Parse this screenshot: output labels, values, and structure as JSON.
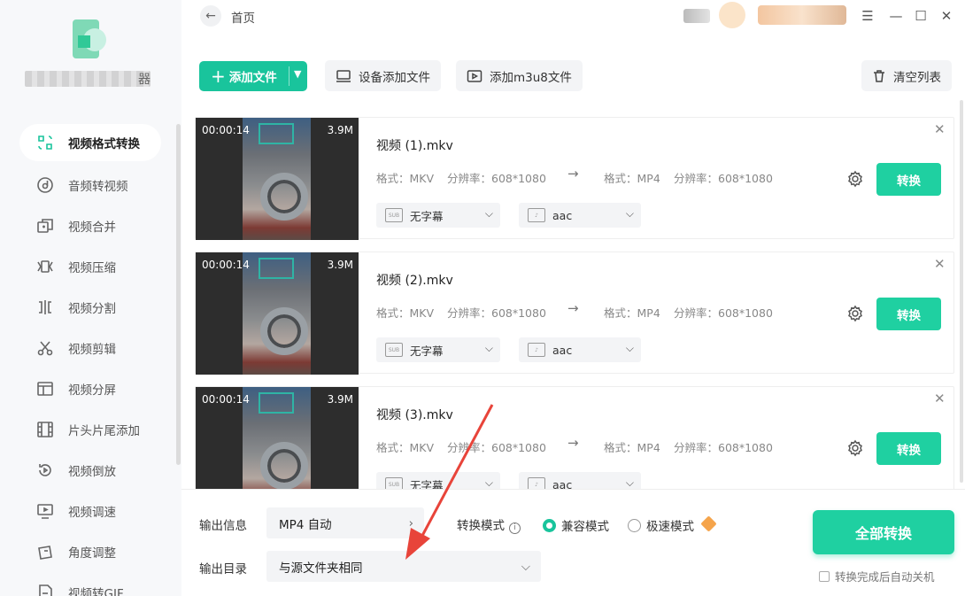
{
  "topbar": {
    "breadcrumb": "首页",
    "back_icon": "arrow-left-icon"
  },
  "sidebar": {
    "app_name_tail": "器",
    "items": [
      {
        "label": "视频格式转换",
        "icon": "format-convert-icon"
      },
      {
        "label": "音频转视频",
        "icon": "audio-icon"
      },
      {
        "label": "视频合并",
        "icon": "merge-icon"
      },
      {
        "label": "视频压缩",
        "icon": "compress-icon"
      },
      {
        "label": "视频分割",
        "icon": "split-icon"
      },
      {
        "label": "视频剪辑",
        "icon": "scissors-icon"
      },
      {
        "label": "视频分屏",
        "icon": "split-screen-icon"
      },
      {
        "label": "片头片尾添加",
        "icon": "film-icon"
      },
      {
        "label": "视频倒放",
        "icon": "reverse-icon"
      },
      {
        "label": "视频调速",
        "icon": "speed-icon"
      },
      {
        "label": "角度调整",
        "icon": "rotate-icon"
      },
      {
        "label": "视频转GIF",
        "icon": "gif-icon"
      }
    ]
  },
  "toolbar": {
    "add_file": "添加文件",
    "device_add": "设备添加文件",
    "add_m3u8": "添加m3u8文件",
    "clear_list": "清空列表"
  },
  "files": [
    {
      "duration": "00:00:14",
      "size": "3.9M",
      "name": "视频 (1).mkv",
      "src_format": "格式：MKV",
      "src_res": "分辨率：608*1080",
      "dst_format": "格式：MP4",
      "dst_res": "分辨率：608*1080",
      "subtitle": "无字幕",
      "audio": "aac",
      "convert": "转换"
    },
    {
      "duration": "00:00:14",
      "size": "3.9M",
      "name": "视频 (2).mkv",
      "src_format": "格式：MKV",
      "src_res": "分辨率：608*1080",
      "dst_format": "格式：MP4",
      "dst_res": "分辨率：608*1080",
      "subtitle": "无字幕",
      "audio": "aac",
      "convert": "转换"
    },
    {
      "duration": "00:00:14",
      "size": "3.9M",
      "name": "视频 (3).mkv",
      "src_format": "格式：MKV",
      "src_res": "分辨率：608*1080",
      "dst_format": "格式：MP4",
      "dst_res": "分辨率：608*1080",
      "subtitle": "无字幕",
      "audio": "aac",
      "convert": "转换"
    }
  ],
  "bottom": {
    "output_info_label": "输出信息",
    "output_info_value": "MP4 自动",
    "mode_label": "转换模式",
    "mode_compat": "兼容模式",
    "mode_fast": "极速模式",
    "output_dir_label": "输出目录",
    "output_dir_value": "与源文件夹相同",
    "convert_all": "全部转换",
    "auto_shutdown": "转换完成后自动关机"
  },
  "colors": {
    "accent": "#19c49c",
    "button": "#1fd0a1",
    "annotation_arrow": "#e8443a",
    "vip": "#f5a44b"
  }
}
